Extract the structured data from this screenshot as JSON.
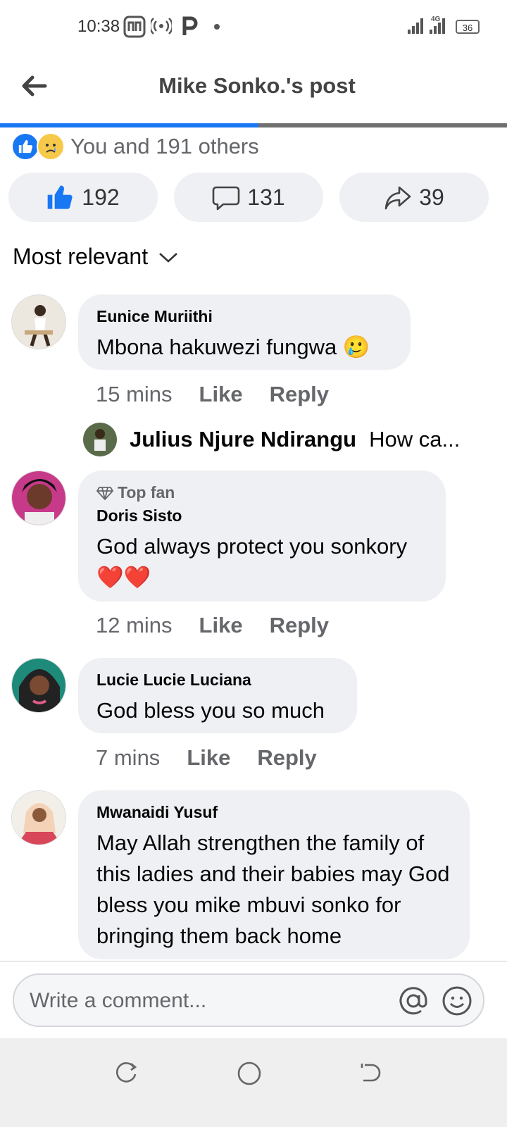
{
  "status_bar": {
    "time": "10:38",
    "network": "4G",
    "battery": "36"
  },
  "header": {
    "title": "Mike Sonko.'s post",
    "progress": 0.51
  },
  "reactions": {
    "summary": "You and 191 others"
  },
  "actions": {
    "likes": "192",
    "comments": "131",
    "shares": "39"
  },
  "sort": {
    "label": "Most relevant"
  },
  "comments": [
    {
      "name": "Eunice Muriithi",
      "text": "Mbona hakuwezi fungwa 🥲",
      "time": "15 mins",
      "like": "Like",
      "reply": "Reply"
    },
    {
      "badge": "Top fan",
      "name": "Doris Sisto",
      "text": "God always protect you sonkory ❤️❤️",
      "time": "12 mins",
      "like": "Like",
      "reply": "Reply"
    },
    {
      "name": "Lucie Lucie Luciana",
      "text": "God bless you so much",
      "time": "7 mins",
      "like": "Like",
      "reply": "Reply"
    },
    {
      "name": "Mwanaidi Yusuf",
      "text": "May Allah strengthen the family of this ladies and  their babies may God bless you mike mbuvi sonko for bringing them back home"
    }
  ],
  "reply_preview": {
    "name": "Julius Njure Ndirangu",
    "text": "How ca..."
  },
  "composer": {
    "placeholder": "Write a comment..."
  },
  "colors": {
    "accent": "#1877f2",
    "bubble": "#eff0f3",
    "muted": "#65676b"
  }
}
